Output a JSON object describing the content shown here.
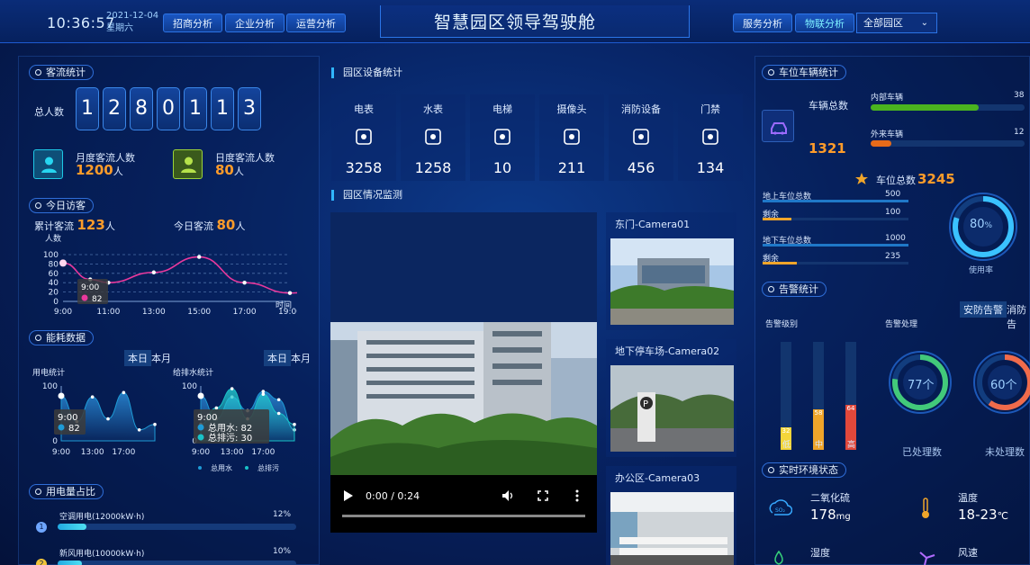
{
  "header": {
    "time": "10:36:57",
    "date": "2021-12-04",
    "weekday": "星期六",
    "nav_left": [
      "招商分析",
      "企业分析",
      "运营分析"
    ],
    "title": "智慧园区领导驾驶舱",
    "nav_right": [
      "服务分析",
      "物联分析"
    ],
    "scope_select": "全部园区"
  },
  "visitor_stats": {
    "section": "客流统计",
    "total_label": "总人数",
    "digits": [
      "1",
      "2",
      "8",
      "0",
      "1",
      "1",
      "3"
    ],
    "monthly_label": "月度客流人数",
    "monthly_value": "1200",
    "unit": "人",
    "daily_label": "日度客流人数",
    "daily_value": "80"
  },
  "today_visitors": {
    "section": "今日访客",
    "cum_label": "累计客流",
    "cum_value": "123",
    "today_label": "今日客流",
    "today_value": "80",
    "unit": "人"
  },
  "today_chart": {
    "type": "line",
    "ylabel": "人数",
    "xlabel": "时间",
    "x_ticks": [
      "9:00",
      "11:00",
      "13:00",
      "15:00",
      "17:00",
      "19:00"
    ],
    "y_ticks": [
      "0",
      "20",
      "40",
      "60",
      "80",
      "100"
    ],
    "ylim": [
      0,
      100
    ],
    "x": [
      0,
      0.6,
      1,
      2,
      3,
      4,
      5,
      6
    ],
    "values": [
      82,
      47,
      40,
      62,
      95,
      40,
      18,
      30
    ],
    "tooltip_time": "9:00",
    "tooltip_value": "82",
    "color": "#e8389c"
  },
  "energy": {
    "section": "能耗数据",
    "tabs_a": [
      "本日",
      "本月"
    ],
    "tabs_b": [
      "本日",
      "本月"
    ],
    "power_label": "用电统计",
    "water_label": "给排水统计",
    "power_chart": {
      "type": "area",
      "x_ticks": [
        "9:00",
        "13:00",
        "17:00"
      ],
      "y_ticks": [
        "0",
        "100"
      ],
      "ylim": [
        0,
        100
      ],
      "values": [
        82,
        35,
        80,
        40,
        88,
        20,
        30
      ],
      "tooltip_time": "9:00",
      "tooltip_value": "82"
    },
    "water_chart": {
      "type": "area",
      "x_ticks": [
        "9:00",
        "13:00",
        "17:00"
      ],
      "y_ticks": [
        "0",
        "100"
      ],
      "ylim": [
        0,
        100
      ],
      "series": [
        {
          "name": "总用水",
          "values": [
            82,
            40,
            80,
            55,
            90,
            75,
            20
          ]
        },
        {
          "name": "总排污",
          "values": [
            30,
            60,
            95,
            40,
            85,
            50,
            30
          ]
        }
      ],
      "tooltip_time": "9:00",
      "tooltip_lines": [
        "总用水: 82",
        "总排污: 30"
      ]
    }
  },
  "power_share": {
    "section": "用电量占比",
    "items": [
      {
        "rank": "1",
        "label": "空调用电(12000kW·h)",
        "pct": "12%",
        "fraction": 0.12
      },
      {
        "rank": "2",
        "label": "新风用电(10000kW·h)",
        "pct": "10%",
        "fraction": 0.1
      }
    ]
  },
  "devices": {
    "section": "园区设备统计",
    "items": [
      {
        "name": "电表",
        "value": "3258",
        "icon": "meter-icon"
      },
      {
        "name": "水表",
        "value": "1258",
        "icon": "water-meter-icon"
      },
      {
        "name": "电梯",
        "value": "10",
        "icon": "elevator-icon"
      },
      {
        "name": "摄像头",
        "value": "211",
        "icon": "camera-icon"
      },
      {
        "name": "消防设备",
        "value": "456",
        "icon": "fire-device-icon"
      },
      {
        "name": "门禁",
        "value": "134",
        "icon": "access-door-icon"
      }
    ]
  },
  "monitor": {
    "section": "园区情况监测",
    "video_time": "0:00 / 0:24",
    "cameras": [
      "东门-Camera01",
      "地下停车场-Camera02",
      "办公区-Camera03"
    ]
  },
  "parking": {
    "section": "车位车辆统计",
    "total_label": "车辆总数",
    "total_value": "1321",
    "internal_label": "内部车辆",
    "internal_value": "38",
    "internal_fraction": 0.38,
    "external_label": "外来车辆",
    "external_value": "12",
    "external_fraction": 0.12,
    "spaces_label": "车位总数",
    "spaces_value": "3245",
    "ground_label": "地上车位总数",
    "ground_value": "500",
    "remain_label": "剩余",
    "ground_remain": "100",
    "ground_remain_fraction": 0.2,
    "underground_label": "地下车位总数",
    "underground_value": "1000",
    "underground_remain": "235",
    "underground_remain_fraction": 0.235,
    "usage_value": "80",
    "usage_unit": "%",
    "usage_label": "使用率",
    "usage_fraction": 0.8
  },
  "alarm": {
    "section": "告警统计",
    "tabs": [
      "安防告警",
      "消防告"
    ],
    "level_label": "告警级别",
    "handle_label": "告警处理",
    "levels": [
      {
        "name": "低",
        "value": 32,
        "fraction": 0.32,
        "color": "#f5d63a"
      },
      {
        "name": "中",
        "value": 58,
        "fraction": 0.58,
        "color": "#f0a52a"
      },
      {
        "name": "高",
        "value": 64,
        "fraction": 0.64,
        "color": "#e2483b"
      }
    ],
    "processed_value": "77",
    "processed_unit": "个",
    "processed_label": "已处理数",
    "processed_fraction": 0.77,
    "unprocessed_value": "60",
    "unprocessed_unit": "个",
    "unprocessed_label": "未处理数",
    "unprocessed_fraction": 0.6
  },
  "environment": {
    "section": "实时环境状态",
    "co2_label": "二氧化硫",
    "co2_value": "178",
    "co2_unit": "mg",
    "temp_label": "温度",
    "temp_value": "18-23",
    "temp_unit": "℃",
    "humidity_label": "湿度",
    "wind_label": "风速"
  }
}
